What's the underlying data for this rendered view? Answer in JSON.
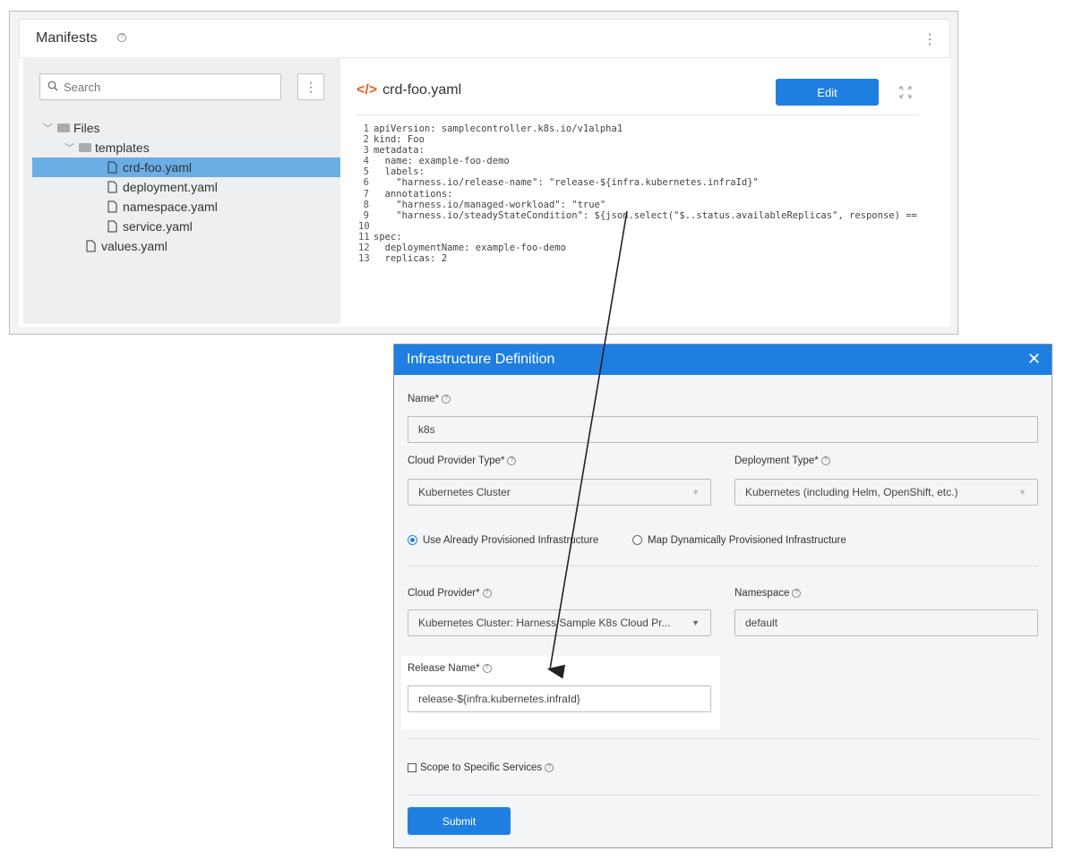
{
  "manifests": {
    "title": "Manifests",
    "search_placeholder": "Search",
    "tree": {
      "root": "Files",
      "folder": "templates",
      "files": [
        "crd-foo.yaml",
        "deployment.yaml",
        "namespace.yaml",
        "service.yaml"
      ],
      "root_file": "values.yaml",
      "selected": "crd-foo.yaml"
    },
    "editor": {
      "filename": "crd-foo.yaml",
      "edit_label": "Edit",
      "lines": [
        "apiVersion: samplecontroller.k8s.io/v1alpha1",
        "kind: Foo",
        "metadata:",
        "  name: example-foo-demo",
        "  labels:",
        "    \"harness.io/release-name\": \"release-${infra.kubernetes.infraId}\"",
        "  annotations:",
        "    \"harness.io/managed-workload\": \"true\"",
        "    \"harness.io/steadyStateCondition\": ${json.select(\"$..status.availableReplicas\", response) ==",
        "",
        "spec:",
        "  deploymentName: example-foo-demo",
        "  replicas: 2"
      ]
    }
  },
  "dialog": {
    "title": "Infrastructure Definition",
    "name_label": "Name*",
    "name_value": "k8s",
    "cloud_provider_type_label": "Cloud Provider Type*",
    "cloud_provider_type_value": "Kubernetes Cluster",
    "deployment_type_label": "Deployment Type*",
    "deployment_type_value": "Kubernetes (including Helm, OpenShift, etc.)",
    "radio_option_1": "Use Already Provisioned Infrastructure",
    "radio_option_2": "Map Dynamically Provisioned Infrastructure",
    "cloud_provider_label": "Cloud Provider*",
    "cloud_provider_value": "Kubernetes Cluster: Harness Sample K8s Cloud Pr...",
    "namespace_label": "Namespace",
    "namespace_value": "default",
    "release_name_label": "Release Name*",
    "release_name_value": "release-${infra.kubernetes.infraId}",
    "scope_label": "Scope to Specific Services",
    "submit_label": "Submit"
  },
  "colors": {
    "accent": "#1f7fe0",
    "selection": "#6aaee6",
    "code_tag": "#e0641f"
  }
}
